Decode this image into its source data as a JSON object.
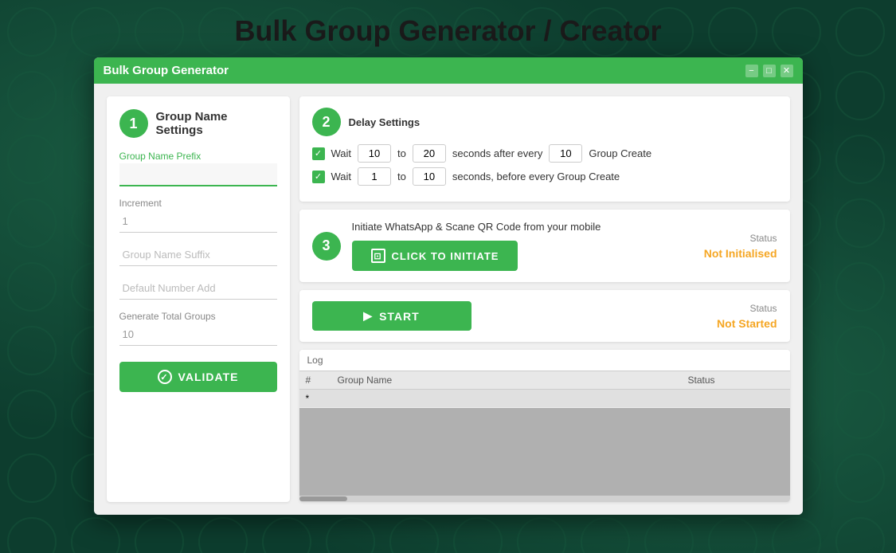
{
  "page": {
    "title": "Bulk Group Generator / Creator"
  },
  "window": {
    "title": "Bulk Group Generator",
    "controls": {
      "minimize": "−",
      "maximize": "□",
      "close": "✕"
    }
  },
  "step1": {
    "number": "1",
    "title": "Group Name Settings",
    "prefix_label": "Group Name Prefix",
    "prefix_value": "",
    "increment_label": "Increment",
    "increment_value": "1",
    "suffix_placeholder": "Group Name Suffix",
    "default_number_placeholder": "Default Number Add",
    "total_label": "Generate Total Groups",
    "total_value": "10",
    "validate_label": "VALIDATE"
  },
  "step2": {
    "number": "2",
    "title": "Delay Settings",
    "row1": {
      "wait_label": "Wait",
      "from": "10",
      "to_label": "to",
      "to_val": "20",
      "after_label": "seconds after every",
      "every_val": "10",
      "end_label": "Group Create"
    },
    "row2": {
      "wait_label": "Wait",
      "from": "1",
      "to_label": "to",
      "to_val": "10",
      "after_label": "seconds, before every Group Create"
    }
  },
  "step3": {
    "number": "3",
    "initiate_text": "Initiate WhatsApp & Scane QR Code from your mobile",
    "initiate_label": "CLICK TO INITIATE",
    "status_label": "Status",
    "status_value": "Not Initialised"
  },
  "start": {
    "label": "START",
    "status_label": "Status",
    "status_value": "Not Started"
  },
  "log": {
    "label": "Log",
    "columns": {
      "hash": "#",
      "group_name": "Group Name",
      "status": "Status"
    },
    "row1_hash": "*"
  }
}
